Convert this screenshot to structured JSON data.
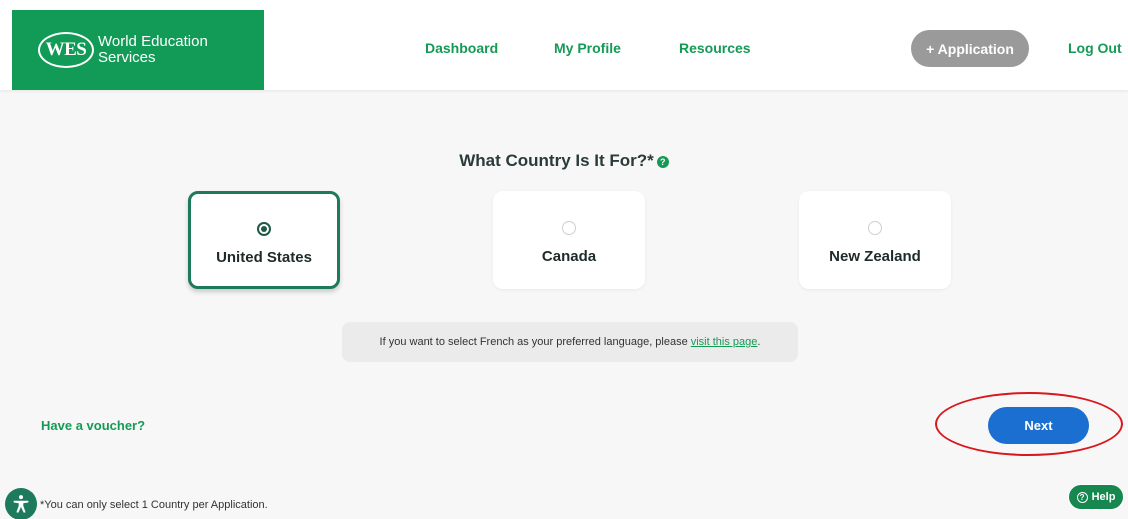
{
  "header": {
    "logo_mark": "WES",
    "logo_line1": "World Education",
    "logo_line2": "Services",
    "nav": {
      "dashboard": "Dashboard",
      "my_profile": "My Profile",
      "resources": "Resources"
    },
    "application_button": "+ Application",
    "logout": "Log Out"
  },
  "main": {
    "title": "What Country Is It For?*",
    "help_glyph": "?",
    "countries": [
      {
        "label": "United States",
        "selected": true
      },
      {
        "label": "Canada",
        "selected": false
      },
      {
        "label": "New Zealand",
        "selected": false
      }
    ],
    "notice_text": "If you want to select French as your preferred language, please",
    "notice_link": "visit this page",
    "notice_end": ".",
    "voucher_link": "Have a voucher?",
    "next_button": "Next",
    "footnote": "*You can only select 1 Country per Application.",
    "help_button": "Help",
    "help_button_glyph": "?"
  },
  "colors": {
    "brand_green": "#119b57",
    "selected_border": "#1d7a5c",
    "next_blue": "#1a6fd0",
    "annotation_red": "#d8181f"
  }
}
